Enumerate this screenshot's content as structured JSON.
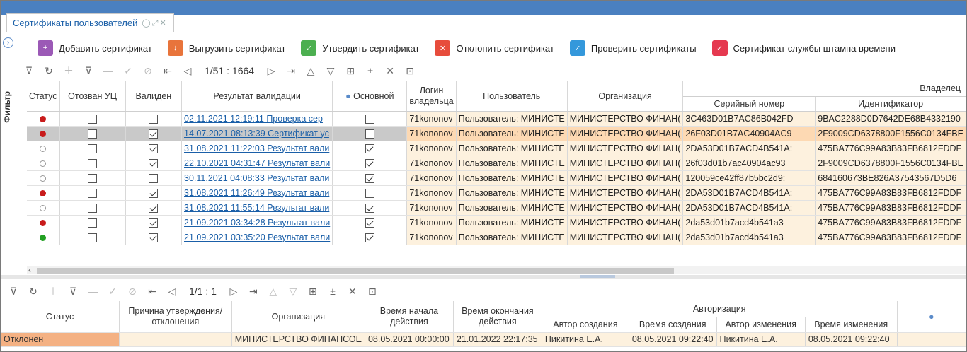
{
  "tab": {
    "title": "Сертификаты пользователей"
  },
  "sidebar": {
    "filter_label": "Фильтр"
  },
  "actions": [
    {
      "label": "Добавить сертификат",
      "icon": "add-certificate-icon",
      "color": "#9b59b6"
    },
    {
      "label": "Выгрузить сертификат",
      "icon": "export-certificate-icon",
      "color": "#e8743b"
    },
    {
      "label": "Утвердить сертификат",
      "icon": "approve-certificate-icon",
      "color": "#4caf50"
    },
    {
      "label": "Отклонить сертификат",
      "icon": "reject-certificate-icon",
      "color": "#e74c3c"
    },
    {
      "label": "Проверить сертификаты",
      "icon": "check-certificates-icon",
      "color": "#3498db"
    },
    {
      "label": "Сертификат службы штампа времени",
      "icon": "timestamp-certificate-icon",
      "color": "#e53950"
    }
  ],
  "toolbar_top": {
    "pager": "1/51 : 1664"
  },
  "toolbar_bottom": {
    "pager": "1/1 : 1"
  },
  "grid": {
    "headers": {
      "status": "Статус",
      "revoked": "Отозван УЦ",
      "valid": "Валиден",
      "result": "Результат валидации",
      "main": "Основной",
      "login": "Логин владельца",
      "user": "Пользователь",
      "org": "Организация",
      "owner": "Владелец",
      "serial": "Серийный номер",
      "ident": "Идентификатор"
    },
    "rows": [
      {
        "status": "red",
        "revoked": false,
        "valid": false,
        "result": "02.11.2021 12:19:11 Проверка сер",
        "main": false,
        "login": "71kononov",
        "user": "Пользователь: МИНИСТЕ",
        "org": "МИНИСТЕРСТВО ФИНАН(",
        "serial": "3C463D01B7AC86B042FD",
        "ident": "9BAC2288D0D7642DE68B4332190"
      },
      {
        "status": "red",
        "revoked": false,
        "valid": true,
        "result": "14.07.2021 08:13:39 Сертификат уc",
        "main": false,
        "login": "71kononov",
        "user": "Пользователь: МИНИСТЕ",
        "org": "МИНИСТЕРСТВО ФИНАН(",
        "serial": "26F03D01B7AC40904AC9",
        "ident": "2F9009CD6378800F1556C0134FBE"
      },
      {
        "status": "none",
        "revoked": false,
        "valid": true,
        "result": "31.08.2021 11:22:03 Результат вали",
        "main": true,
        "login": "71kononov",
        "user": "Пользователь: МИНИСТЕ",
        "org": "МИНИСТЕРСТВО ФИНАН(",
        "serial": "2DA53D01B7ACD4B541A:",
        "ident": "475BA776C99A83B83FB6812FDDF"
      },
      {
        "status": "none",
        "revoked": false,
        "valid": true,
        "result": "22.10.2021 04:31:47 Результат вали",
        "main": true,
        "login": "71kononov",
        "user": "Пользователь: МИНИСТЕ",
        "org": "МИНИСТЕРСТВО ФИНАН(",
        "serial": "26f03d01b7ac40904ac93",
        "ident": "2F9009CD6378800F1556C0134FBE"
      },
      {
        "status": "none",
        "revoked": false,
        "valid": false,
        "result": "30.11.2021 04:08:33 Результат вали",
        "main": true,
        "login": "71kononov",
        "user": "Пользователь: МИНИСТЕ",
        "org": "МИНИСТЕРСТВО ФИНАН(",
        "serial": "120059ce42ff87b5bc2d9:",
        "ident": "684160673BE826A37543567D5D6"
      },
      {
        "status": "red",
        "revoked": false,
        "valid": true,
        "result": "31.08.2021 11:26:49 Результат вали",
        "main": false,
        "login": "71kononov",
        "user": "Пользователь: МИНИСТЕ",
        "org": "МИНИСТЕРСТВО ФИНАН(",
        "serial": "2DA53D01B7ACD4B541A:",
        "ident": "475BA776C99A83B83FB6812FDDF"
      },
      {
        "status": "none",
        "revoked": false,
        "valid": true,
        "result": "31.08.2021 11:55:14 Результат вали",
        "main": true,
        "login": "71kononov",
        "user": "Пользователь: МИНИСТЕ",
        "org": "МИНИСТЕРСТВО ФИНАН(",
        "serial": "2DA53D01B7ACD4B541A:",
        "ident": "475BA776C99A83B83FB6812FDDF"
      },
      {
        "status": "red",
        "revoked": false,
        "valid": true,
        "result": "21.09.2021 03:34:28 Результат вали",
        "main": true,
        "login": "71kononov",
        "user": "Пользователь: МИНИСТЕ",
        "org": "МИНИСТЕРСТВО ФИНАН(",
        "serial": "2da53d01b7acd4b541a3",
        "ident": "475BA776C99A83B83FB6812FDDF"
      },
      {
        "status": "green",
        "revoked": false,
        "valid": true,
        "result": "21.09.2021 03:35:20 Результат вали",
        "main": true,
        "login": "71kononov",
        "user": "Пользователь: МИНИСТЕ",
        "org": "МИНИСТЕРСТВО ФИНАН(",
        "serial": "2da53d01b7acd4b541a3",
        "ident": "475BA776C99A83B83FB6812FDDF"
      }
    ],
    "selected_row": 1
  },
  "grid2": {
    "headers": {
      "status": "Статус",
      "reason": "Причина утверждения/отклонения",
      "org": "Организация",
      "start": "Время начала действия",
      "end": "Время окончания действия",
      "auth": "Авторизация",
      "author_c": "Автор создания",
      "time_c": "Время создания",
      "author_m": "Автор изменения",
      "time_m": "Время изменения"
    },
    "row": {
      "status": "Отклонен",
      "reason": "",
      "org": "МИНИСТЕРСТВО ФИНАНСОЕ",
      "start": "08.05.2021 00:00:00",
      "end": "21.01.2022 22:17:35",
      "author_c": "Никитина Е.А.",
      "time_c": "08.05.2021 09:22:40",
      "author_m": "Никитина Е.А.",
      "time_m": "08.05.2021 09:22:40"
    }
  }
}
